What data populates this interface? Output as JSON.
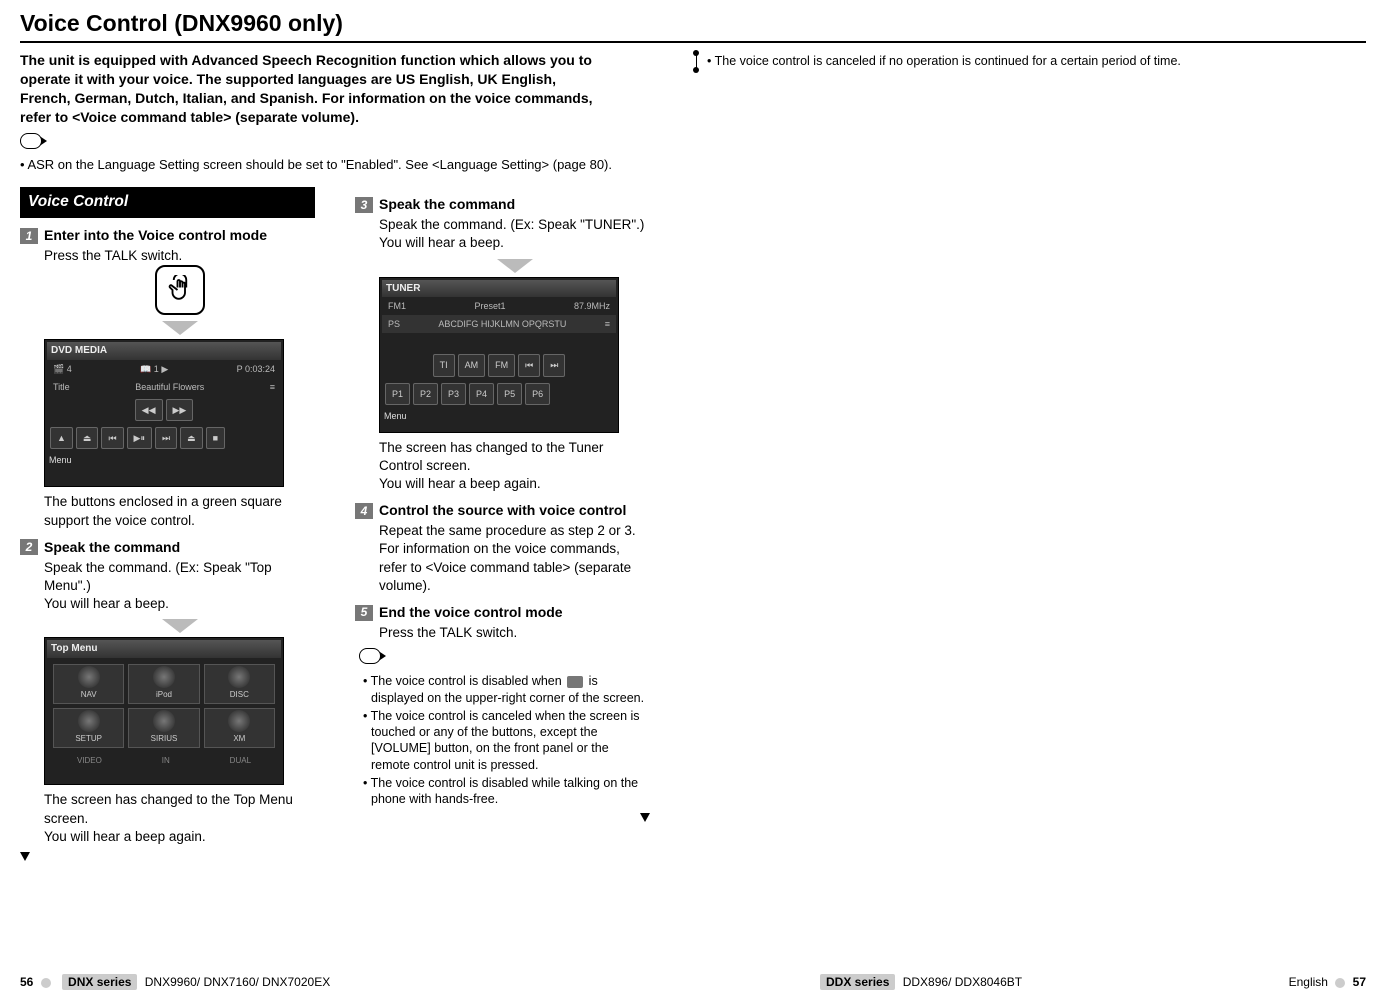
{
  "page": {
    "title": "Voice Control (DNX9960 only)",
    "intro": "The unit is equipped with Advanced Speech Recognition function which allows you to operate it with your voice. The supported languages are US English, UK English, French, German, Dutch, Italian, and Spanish. For information on the voice commands, refer to <Voice command table> (separate volume).",
    "asr_note": "ASR on the Language Setting screen should be set to \"Enabled\". See <Language Setting> (page 80).",
    "top_right_note": "The voice control is canceled if no operation is continued for a certain period of time."
  },
  "voice_control_header": "Voice Control",
  "steps": {
    "s1": {
      "num": "1",
      "title": "Enter into the Voice control mode",
      "line1": "Press the TALK switch.",
      "after": "The buttons enclosed in a green square support the voice control."
    },
    "s2": {
      "num": "2",
      "title": "Speak the command",
      "line1": "Speak the command. (Ex: Speak \"Top Menu\".)",
      "line2": "You will hear a beep.",
      "after1": "The screen has changed to the Top Menu screen.",
      "after2": "You will hear a beep again."
    },
    "s3": {
      "num": "3",
      "title": "Speak the command",
      "line1": "Speak the command. (Ex: Speak \"TUNER\".)",
      "line2": "You will hear a beep.",
      "after1": "The screen has changed to the Tuner Control screen.",
      "after2": "You will hear a beep again."
    },
    "s4": {
      "num": "4",
      "title": "Control the source with voice control",
      "line1": "Repeat the same procedure as step 2 or 3.",
      "line2": "For information on the voice commands, refer to <Voice command table> (separate volume)."
    },
    "s5": {
      "num": "5",
      "title": "End the voice control mode",
      "line1": "Press the TALK switch."
    }
  },
  "end_notes": {
    "n1a": "The voice control is disabled when",
    "n1b": "is displayed on the upper-right corner of the screen.",
    "n2": "The voice control is canceled when the screen is touched or any of the buttons, except the [VOLUME] button, on the front panel or the remote control unit is pressed.",
    "n3": "The voice control is disabled while talking on the phone with hands-free."
  },
  "screens": {
    "dvd": {
      "title": "DVD MEDIA",
      "track_label": "Title",
      "track": "Beautiful Flowers",
      "chap": "1",
      "play": "P",
      "time": "0:03:24",
      "menu": "Menu",
      "btns": [
        "▲",
        "⏏",
        "⏮",
        "▶⏸",
        "⏭",
        "⏏",
        "■"
      ]
    },
    "topmenu": {
      "title": "Top Menu",
      "tiles": [
        "NAV",
        "iPod",
        "DISC",
        "SETUP",
        "SIRIUS",
        "XM"
      ],
      "bot": [
        "VIDEO",
        "IN",
        "DUAL"
      ]
    },
    "tuner": {
      "title": "TUNER",
      "band": "FM1",
      "preset": "Preset1",
      "freq": "87.9MHz",
      "ps": "PS",
      "rds": "ABCDIFG HIJKLMN OPQRSTU",
      "btns": [
        "TI",
        "AM",
        "FM",
        "⏮",
        "⏭"
      ],
      "presets": [
        "P1",
        "P2",
        "P3",
        "P4",
        "P5",
        "P6"
      ],
      "menu": "Menu"
    }
  },
  "footer": {
    "left_page": "56",
    "left_series": "DNX series",
    "left_models": "DNX9960/ DNX7160/ DNX7020EX",
    "right_series": "DDX series",
    "right_models": "DDX896/ DDX8046BT",
    "lang": "English",
    "right_page": "57"
  }
}
